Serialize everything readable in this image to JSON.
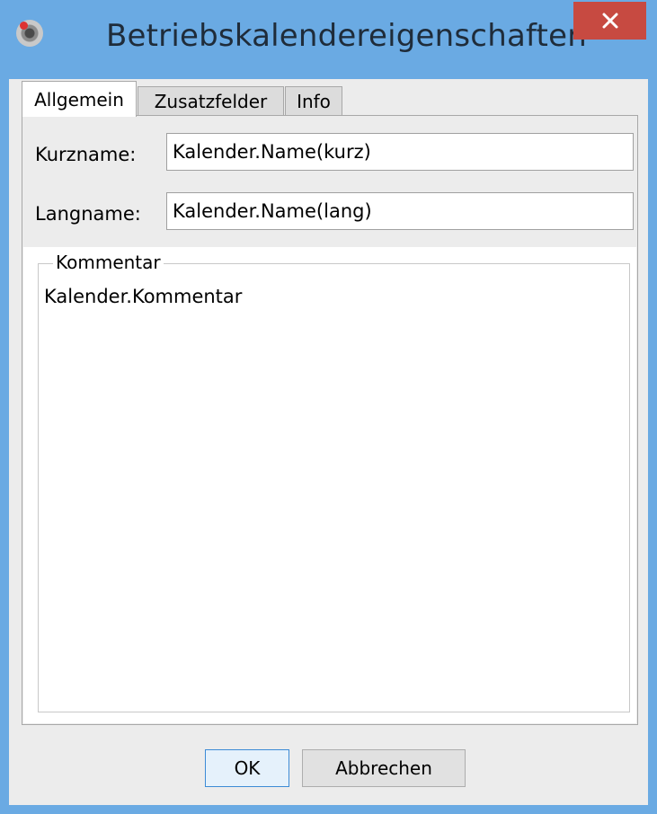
{
  "window": {
    "title": "Betriebskalendereigenschaften",
    "close_symbol": "×"
  },
  "tabs": [
    {
      "label": "Allgemein",
      "active": true
    },
    {
      "label": "Zusatzfelder",
      "active": false
    },
    {
      "label": "Info",
      "active": false
    }
  ],
  "form": {
    "kurzname_label": "Kurzname:",
    "kurzname_value": "Kalender.Name(kurz)",
    "langname_label": "Langname:",
    "langname_value": "Kalender.Name(lang)",
    "comment_group_title": "Kommentar",
    "comment_text": "Kalender.Kommentar"
  },
  "buttons": {
    "ok_label": "OK",
    "cancel_label": "Abbrechen"
  },
  "icons": {
    "app": "calendar-gear-icon",
    "close": "close-icon"
  },
  "colors": {
    "title_bar": "#6aaae3",
    "close_button": "#c74a41",
    "client_background": "#ececec"
  }
}
